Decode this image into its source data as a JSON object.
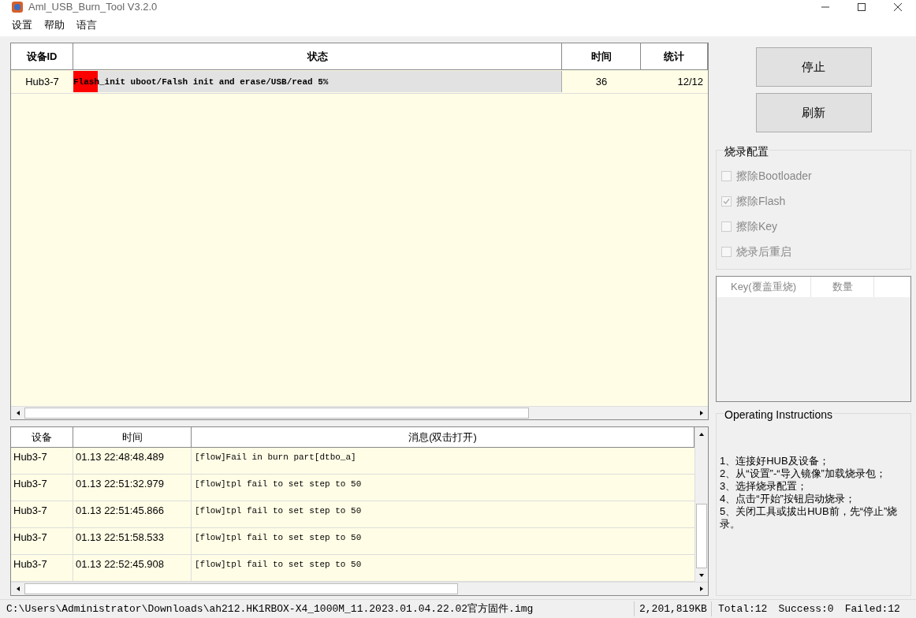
{
  "window": {
    "title": "Aml_USB_Burn_Tool V3.2.0"
  },
  "menu": [
    "设置",
    "帮助",
    "语言"
  ],
  "device_table": {
    "columns": [
      "设备ID",
      "状态",
      "时间",
      "统计"
    ],
    "rows": [
      {
        "device_id": "Hub3-7",
        "status": "Flash_init uboot/Falsh init and erase/USB/read 5%",
        "level": 0.05,
        "time": "36",
        "count": "12/12"
      }
    ]
  },
  "log_table": {
    "columns": [
      "设备",
      "时间",
      "消息(双击打开)"
    ],
    "rows": [
      {
        "device": "Hub3-7",
        "time": "01.13 22:48:48.489",
        "message": "[flow]Fail in burn part[dtbo_a]"
      },
      {
        "device": "Hub3-7",
        "time": "01.13 22:51:32.979",
        "message": "[flow]tpl fail to set step to 50"
      },
      {
        "device": "Hub3-7",
        "time": "01.13 22:51:45.866",
        "message": "[flow]tpl fail to set step to 50"
      },
      {
        "device": "Hub3-7",
        "time": "01.13 22:51:58.533",
        "message": "[flow]tpl fail to set step to 50"
      },
      {
        "device": "Hub3-7",
        "time": "01.13 22:52:45.908",
        "message": "[flow]tpl fail to set step to 50"
      }
    ]
  },
  "buttons": [
    "停止",
    "刷新"
  ],
  "burn_config": {
    "title": "烧录配置",
    "options": [
      {
        "label": "擦除Bootloader",
        "checked": false,
        "disabled": true
      },
      {
        "label": "擦除Flash",
        "checked": true,
        "disabled": true
      },
      {
        "label": "擦除Key",
        "checked": false,
        "disabled": true
      },
      {
        "label": "烧录后重启",
        "checked": false,
        "disabled": true
      }
    ]
  },
  "key_table": {
    "columns": [
      "Key(覆盖重烧)",
      "数量"
    ]
  },
  "instructions": {
    "title": "Operating Instructions",
    "lines": [
      "1、连接好HUB及设备；",
      "2、从“设置”-“导入镜像”加载烧录包；",
      "3、选择烧录配置；",
      "4、点击“开始”按钮启动烧录；",
      "5、关闭工具或拔出HUB前，先“停止”烧录。"
    ]
  },
  "status_bar": {
    "path": "C:\\Users\\Administrator\\Downloads\\ah212.HK1RBOX-X4_1000M_11.2023.01.04.22.02官方固件.img",
    "size": "2,201,819KB",
    "total": "Total:12",
    "success": "Success:0",
    "failed": "Failed:12"
  }
}
